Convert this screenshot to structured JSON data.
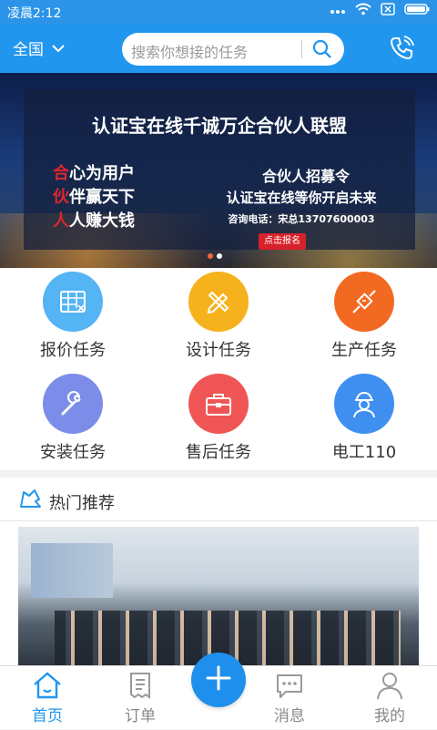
{
  "status_bar": {
    "time": "凌晨2:12"
  },
  "header": {
    "region": "全国",
    "search_placeholder": "搜索你想接的任务"
  },
  "banner": {
    "title": "认证宝在线千诚万企合伙人联盟",
    "slogans": [
      {
        "accent": "合",
        "rest": "心为用户"
      },
      {
        "accent": "伙",
        "rest": "伴赢天下"
      },
      {
        "accent": "人",
        "rest": "人赚大钱"
      }
    ],
    "recruit_title": "合伙人招募令",
    "recruit_sub": "认证宝在线等你开启未来",
    "recruit_phone": "咨询电话：宋总13707600003",
    "signup": "点击报名",
    "slide_count": 2,
    "active_slide": 1
  },
  "grid": {
    "items": [
      {
        "label": "报价任务",
        "icon": "quote-icon",
        "color": "#54b4f4"
      },
      {
        "label": "设计任务",
        "icon": "design-icon",
        "color": "#f6b21c"
      },
      {
        "label": "生产任务",
        "icon": "production-icon",
        "color": "#f26a22"
      },
      {
        "label": "安装任务",
        "icon": "wrench-icon",
        "color": "#7b8de8"
      },
      {
        "label": "售后任务",
        "icon": "toolbox-icon",
        "color": "#f05555"
      },
      {
        "label": "电工110",
        "icon": "electrician-icon",
        "color": "#3f8ff0"
      }
    ]
  },
  "hot": {
    "label": "热门推荐"
  },
  "tabbar": {
    "items": [
      {
        "label": "首页",
        "icon": "home-icon",
        "active": true
      },
      {
        "label": "订单",
        "icon": "order-icon",
        "active": false
      },
      {
        "label": "消息",
        "icon": "message-icon",
        "active": false
      },
      {
        "label": "我的",
        "icon": "profile-icon",
        "active": false
      }
    ],
    "center": {
      "icon": "plus-icon"
    }
  },
  "colors": {
    "primary": "#2196ee",
    "accent_red": "#e0262c"
  }
}
